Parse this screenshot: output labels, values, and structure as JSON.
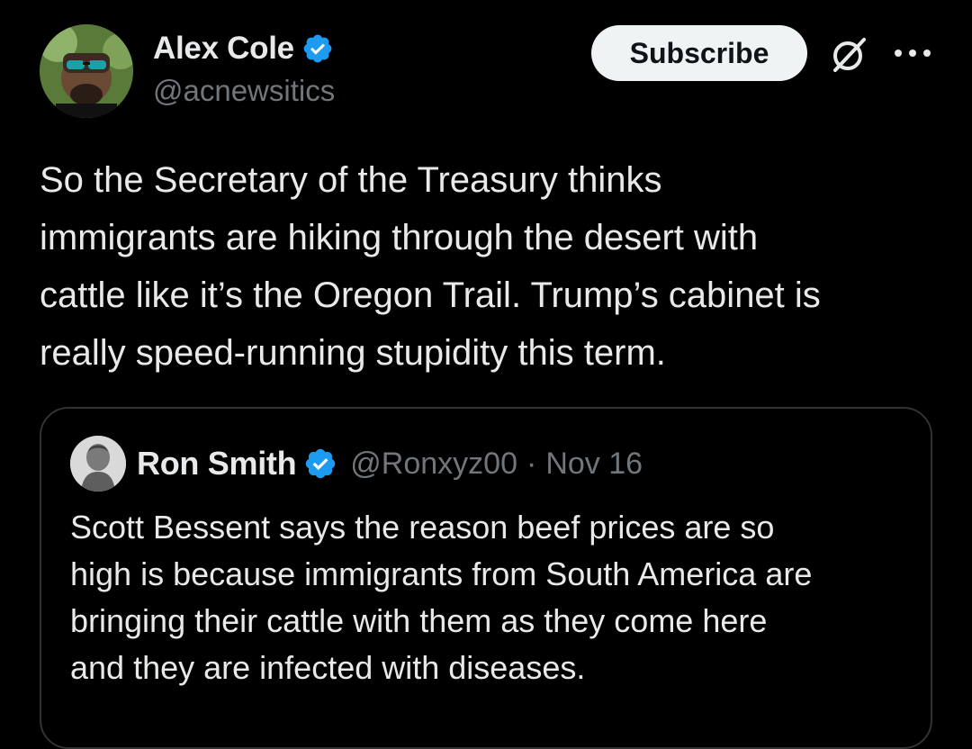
{
  "author": {
    "display_name": "Alex Cole",
    "handle": "@acnewsitics",
    "avatar_icon": "profile-photo-sunglasses",
    "badge_icon": "verified-badge-icon"
  },
  "actions": {
    "subscribe_label": "Subscribe",
    "grok_icon": "grok-icon",
    "more_icon": "more-dots-icon"
  },
  "tweet": {
    "lines": [
      "So the Secretary of the Treasury thinks",
      "immigrants are hiking through the desert with",
      "cattle like it’s the Oregon Trail. Trump’s cabinet is",
      "really speed-running stupidity this term."
    ]
  },
  "quoted": {
    "display_name": "Ron Smith",
    "handle": "@Ronxyz00",
    "separator": "·",
    "date": "Nov 16",
    "lines": [
      "Scott Bessent says the reason beef prices are so",
      "high is because immigrants from South America are",
      "bringing their cattle with them as they come here",
      "and they are infected with diseases."
    ]
  },
  "colors": {
    "background": "#000000",
    "text_primary": "#e7e9ea",
    "text_secondary": "#71767b",
    "verified_blue": "#1d9bf0",
    "border": "#2f3336",
    "subscribe_bg": "#eff3f4"
  }
}
